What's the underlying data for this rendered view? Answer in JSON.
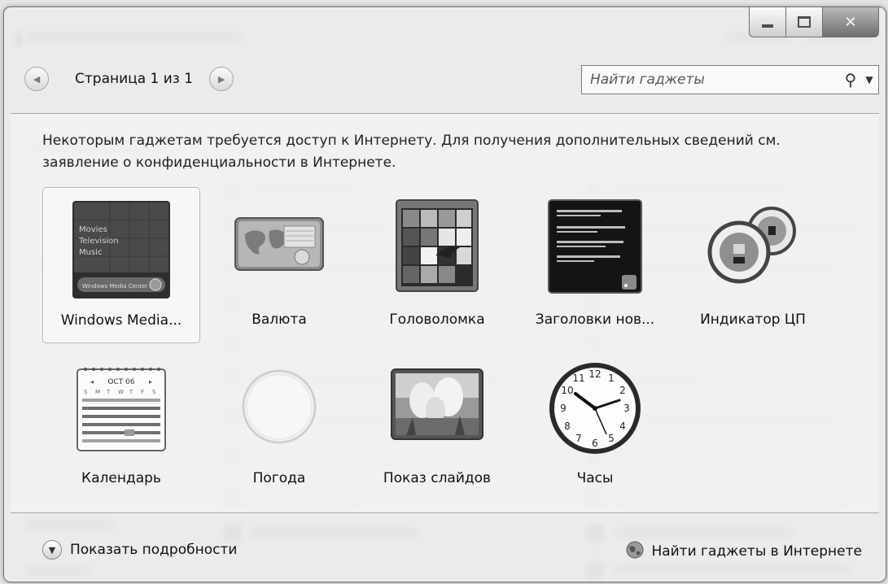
{
  "nav": {
    "page_label": "Страница 1 из 1"
  },
  "search": {
    "placeholder": "Найти гаджеты"
  },
  "info_text": "Некоторым гаджетам требуется доступ к Интернету. Для получения дополнительных сведений см. заявление о конфиденциальности в Интернете.",
  "gadgets": [
    {
      "label": "Windows Media...",
      "icon": "windows-media-center-icon",
      "selected": true
    },
    {
      "label": "Валюта",
      "icon": "currency-icon"
    },
    {
      "label": "Головоломка",
      "icon": "puzzle-icon"
    },
    {
      "label": "Заголовки нов...",
      "icon": "feed-headlines-icon"
    },
    {
      "label": "Индикатор ЦП",
      "icon": "cpu-meter-icon"
    },
    {
      "label": "Календарь",
      "icon": "calendar-icon"
    },
    {
      "label": "Погода",
      "icon": "weather-icon"
    },
    {
      "label": "Показ слайдов",
      "icon": "slideshow-icon"
    },
    {
      "label": "Часы",
      "icon": "clock-icon"
    }
  ],
  "wmc_text": {
    "line1": "Movies",
    "line2": "Television",
    "line3": "Music",
    "bar": "Windows Media Center"
  },
  "calendar": {
    "month": "OCT 06",
    "days": [
      "S",
      "M",
      "T",
      "W",
      "T",
      "F",
      "S"
    ]
  },
  "footer": {
    "details_label": "Показать подробности",
    "online_label": "Найти гаджеты в Интернете"
  }
}
